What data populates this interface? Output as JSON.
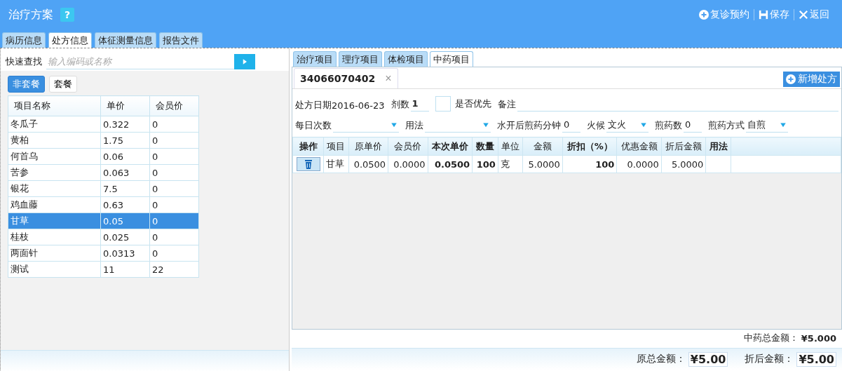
{
  "window": {
    "title": "治疗方案",
    "help": "?"
  },
  "actions": [
    {
      "label": "复诊预约",
      "kind": "add"
    },
    {
      "label": "保存",
      "kind": "save"
    },
    {
      "label": "返回",
      "kind": "close"
    }
  ],
  "tabs": [
    {
      "label": "病历信息",
      "selected": false
    },
    {
      "label": "处方信息",
      "selected": true
    },
    {
      "label": "体征测量信息",
      "selected": false
    },
    {
      "label": "报告文件",
      "selected": false
    }
  ],
  "quick_search": {
    "label": "快速查找",
    "placeholder": "输入编码或名称"
  },
  "package_tabs": [
    {
      "label": "非套餐",
      "selected": true
    },
    {
      "label": "套餐",
      "selected": false
    }
  ],
  "item_table": {
    "columns": [
      "项目名称",
      "单价",
      "会员价"
    ],
    "rows": [
      {
        "cells": [
          "冬瓜子",
          "0.322",
          "0"
        ],
        "selected": false
      },
      {
        "cells": [
          "黄柏",
          "1.75",
          "0"
        ],
        "selected": false
      },
      {
        "cells": [
          "何首乌",
          "0.06",
          "0"
        ],
        "selected": false
      },
      {
        "cells": [
          "苦参",
          "0.063",
          "0"
        ],
        "selected": false
      },
      {
        "cells": [
          "银花",
          "7.5",
          "0"
        ],
        "selected": false
      },
      {
        "cells": [
          "鸡血藤",
          "0.63",
          "0"
        ],
        "selected": false
      },
      {
        "cells": [
          "甘草",
          "0.05",
          "0"
        ],
        "selected": true
      },
      {
        "cells": [
          "桂枝",
          "0.025",
          "0"
        ],
        "selected": false
      },
      {
        "cells": [
          "两面针",
          "0.0313",
          "0"
        ],
        "selected": false
      },
      {
        "cells": [
          "测试",
          "11",
          "22"
        ],
        "selected": false
      }
    ]
  },
  "item_tabs": [
    {
      "label": "治疗项目",
      "selected": false
    },
    {
      "label": "理疗项目",
      "selected": false
    },
    {
      "label": "体检项目",
      "selected": false
    },
    {
      "label": "中药项目",
      "selected": true
    }
  ],
  "prescription_tab": {
    "label": "34066070402",
    "close": "×"
  },
  "new_prescription_button": "新增处方",
  "form_rows": [
    [
      {
        "kind": "text",
        "label": "处方日期",
        "value": "2016-06-23"
      },
      {
        "kind": "input",
        "label": "剂数",
        "value": "1"
      },
      {
        "kind": "checkbox",
        "label": "是否优先",
        "checked": false
      },
      {
        "kind": "wide",
        "label": "备注"
      }
    ],
    [
      {
        "kind": "select",
        "label": "每日次数"
      },
      {
        "kind": "select",
        "label": "用法"
      },
      {
        "kind": "input",
        "label": "水开后煎药分钟",
        "value": "0"
      },
      {
        "kind": "select",
        "label": "火候",
        "value": "文火"
      },
      {
        "kind": "input",
        "label": "煎药数",
        "value": "0"
      },
      {
        "kind": "select",
        "label": "煎药方式",
        "value": "自煎"
      }
    ]
  ],
  "detail_table": {
    "columns": [
      {
        "label": "操作",
        "bold": true,
        "kind": "action"
      },
      {
        "label": "项目",
        "bold": false,
        "kind": "text"
      },
      {
        "label": "原单价",
        "bold": false,
        "kind": "number"
      },
      {
        "label": "会员价",
        "bold": false,
        "kind": "number"
      },
      {
        "label": "本次单价",
        "bold": true,
        "kind": "number"
      },
      {
        "label": "数量",
        "bold": true,
        "kind": "number"
      },
      {
        "label": "单位",
        "bold": false,
        "kind": "text"
      },
      {
        "label": "金额",
        "bold": false,
        "kind": "number"
      },
      {
        "label": "折扣（%）",
        "bold": true,
        "kind": "number"
      },
      {
        "label": "优惠金额",
        "bold": false,
        "kind": "number"
      },
      {
        "label": "折后金额",
        "bold": false,
        "kind": "number"
      },
      {
        "label": "用法",
        "bold": true,
        "kind": "text"
      }
    ],
    "rows": [
      {
        "cells": [
          "",
          "甘草",
          "0.0500",
          "0.0000",
          "0.0500",
          "100",
          "克",
          "5.0000",
          "100",
          "0.0000",
          "5.0000",
          ""
        ]
      }
    ]
  },
  "totals": {
    "herbal_total": {
      "label": "中药总金额：",
      "value": "¥5.000"
    },
    "original_total": {
      "label": "原总金额：",
      "value": "¥5.00"
    },
    "discounted_total": {
      "label": "折后金额：",
      "value": "¥5.00"
    }
  }
}
